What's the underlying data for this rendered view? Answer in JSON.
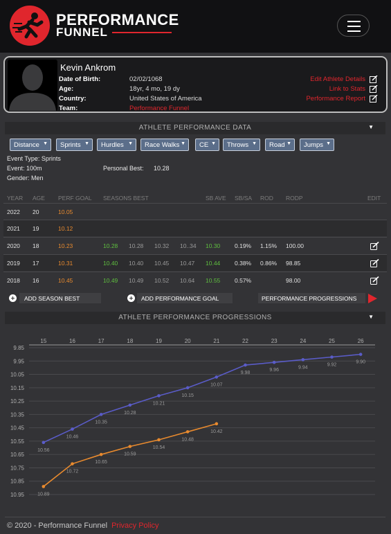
{
  "header": {
    "brand_line1": "PERFORMANCE",
    "brand_line2": "FUNNEL",
    "logo_icon": "running-man-logo",
    "menu_icon": "hamburger-icon"
  },
  "athlete": {
    "name": "Kevin Ankrom",
    "fields": [
      {
        "label": "Date of Birth:",
        "value": "02/02/1068"
      },
      {
        "label": "Age:",
        "value": "18yr, 4 mo, 19 dy"
      },
      {
        "label": "Country:",
        "value": "United States of America"
      },
      {
        "label": "Team:",
        "value": "Performance Funnel"
      }
    ],
    "links": [
      "Edit Athlete Details",
      "Link to Stats",
      "Performance Report"
    ]
  },
  "performance_section": {
    "title": "ATHLETE PERFORMANCE DATA",
    "filters": [
      "Distance",
      "Sprints",
      "Hurdles",
      "Race Walks",
      "CE",
      "Throws",
      "Road",
      "Jumps"
    ],
    "event_type": "Event Type: Sprints",
    "event": "Event: 100m",
    "gender": "Gender: Men",
    "personal_best_label": "Personal Best:",
    "personal_best_value": "10.28"
  },
  "table": {
    "headers": [
      "YEAR",
      "AGE",
      "PERF GOAL",
      "SEASONS BEST",
      "SB AVE",
      "SB/SA",
      "ROD",
      "RODP",
      "EDIT"
    ],
    "rows": [
      {
        "year": "2022",
        "age": "20",
        "goal": "10.05",
        "best": [
          "",
          "",
          "",
          ""
        ],
        "sbave": "",
        "sbsa": "",
        "rod": "",
        "rodp": "",
        "editable": false
      },
      {
        "year": "2021",
        "age": "19",
        "goal": "10.12",
        "best": [
          "",
          "",
          "",
          ""
        ],
        "sbave": "",
        "sbsa": "",
        "rod": "",
        "rodp": "",
        "editable": false
      },
      {
        "year": "2020",
        "age": "18",
        "goal": "10.23",
        "best": [
          "10.28",
          "10.28",
          "10.32",
          "10..34"
        ],
        "sbave": "10.30",
        "sbsa": "0.19%",
        "rod": "1.15%",
        "rodp": "100.00",
        "editable": true
      },
      {
        "year": "2019",
        "age": "17",
        "goal": "10.31",
        "best": [
          "10.40",
          "10.40",
          "10.45",
          "10.47"
        ],
        "sbave": "10.44",
        "sbsa": "0.38%",
        "rod": "0.86%",
        "rodp": "98.85",
        "editable": true
      },
      {
        "year": "2018",
        "age": "16",
        "goal": "10.45",
        "best": [
          "10.49",
          "10.49",
          "10.52",
          "10.64"
        ],
        "sbave": "10.55",
        "sbsa": "0.57%",
        "rod": "",
        "rodp": "98.00",
        "editable": true
      }
    ]
  },
  "actions": {
    "add_season_best": "ADD SEASON BEST",
    "add_goal": "ADD PERFORMANCE GOAL",
    "progressions": "PERFORMANCE PROGRESSIONS"
  },
  "progressions_section": {
    "title": "ATHLETE PERFORMANCE PROGRESSIONS"
  },
  "chart_data": {
    "type": "line",
    "x": [
      15,
      16,
      17,
      18,
      19,
      20,
      21,
      22,
      23,
      24,
      25,
      26
    ],
    "y_ticks": [
      "9.85",
      "9.95",
      "10.05",
      "10.15",
      "10.25",
      "10.35",
      "10.45",
      "10.55",
      "10.65",
      "10.75",
      "10.85",
      "10.95"
    ],
    "ylim": [
      9.85,
      10.95
    ],
    "y_inverted": true,
    "grid": true,
    "series": [
      {
        "color": "#5a5cc8",
        "x": [
          15,
          16,
          17,
          18,
          19,
          20,
          21,
          22,
          23,
          24,
          25,
          26
        ],
        "values": [
          10.56,
          10.46,
          10.35,
          10.28,
          10.21,
          10.15,
          10.07,
          9.98,
          9.96,
          9.94,
          9.92,
          9.9
        ]
      },
      {
        "color": "#e88a2e",
        "x": [
          15,
          16,
          17,
          18,
          19,
          20,
          21
        ],
        "values": [
          10.89,
          10.72,
          10.65,
          10.59,
          10.54,
          10.48,
          10.42
        ]
      }
    ]
  },
  "footer": {
    "copyright": "© 2020 - Performance Funnel",
    "privacy": "Privacy Policy"
  }
}
